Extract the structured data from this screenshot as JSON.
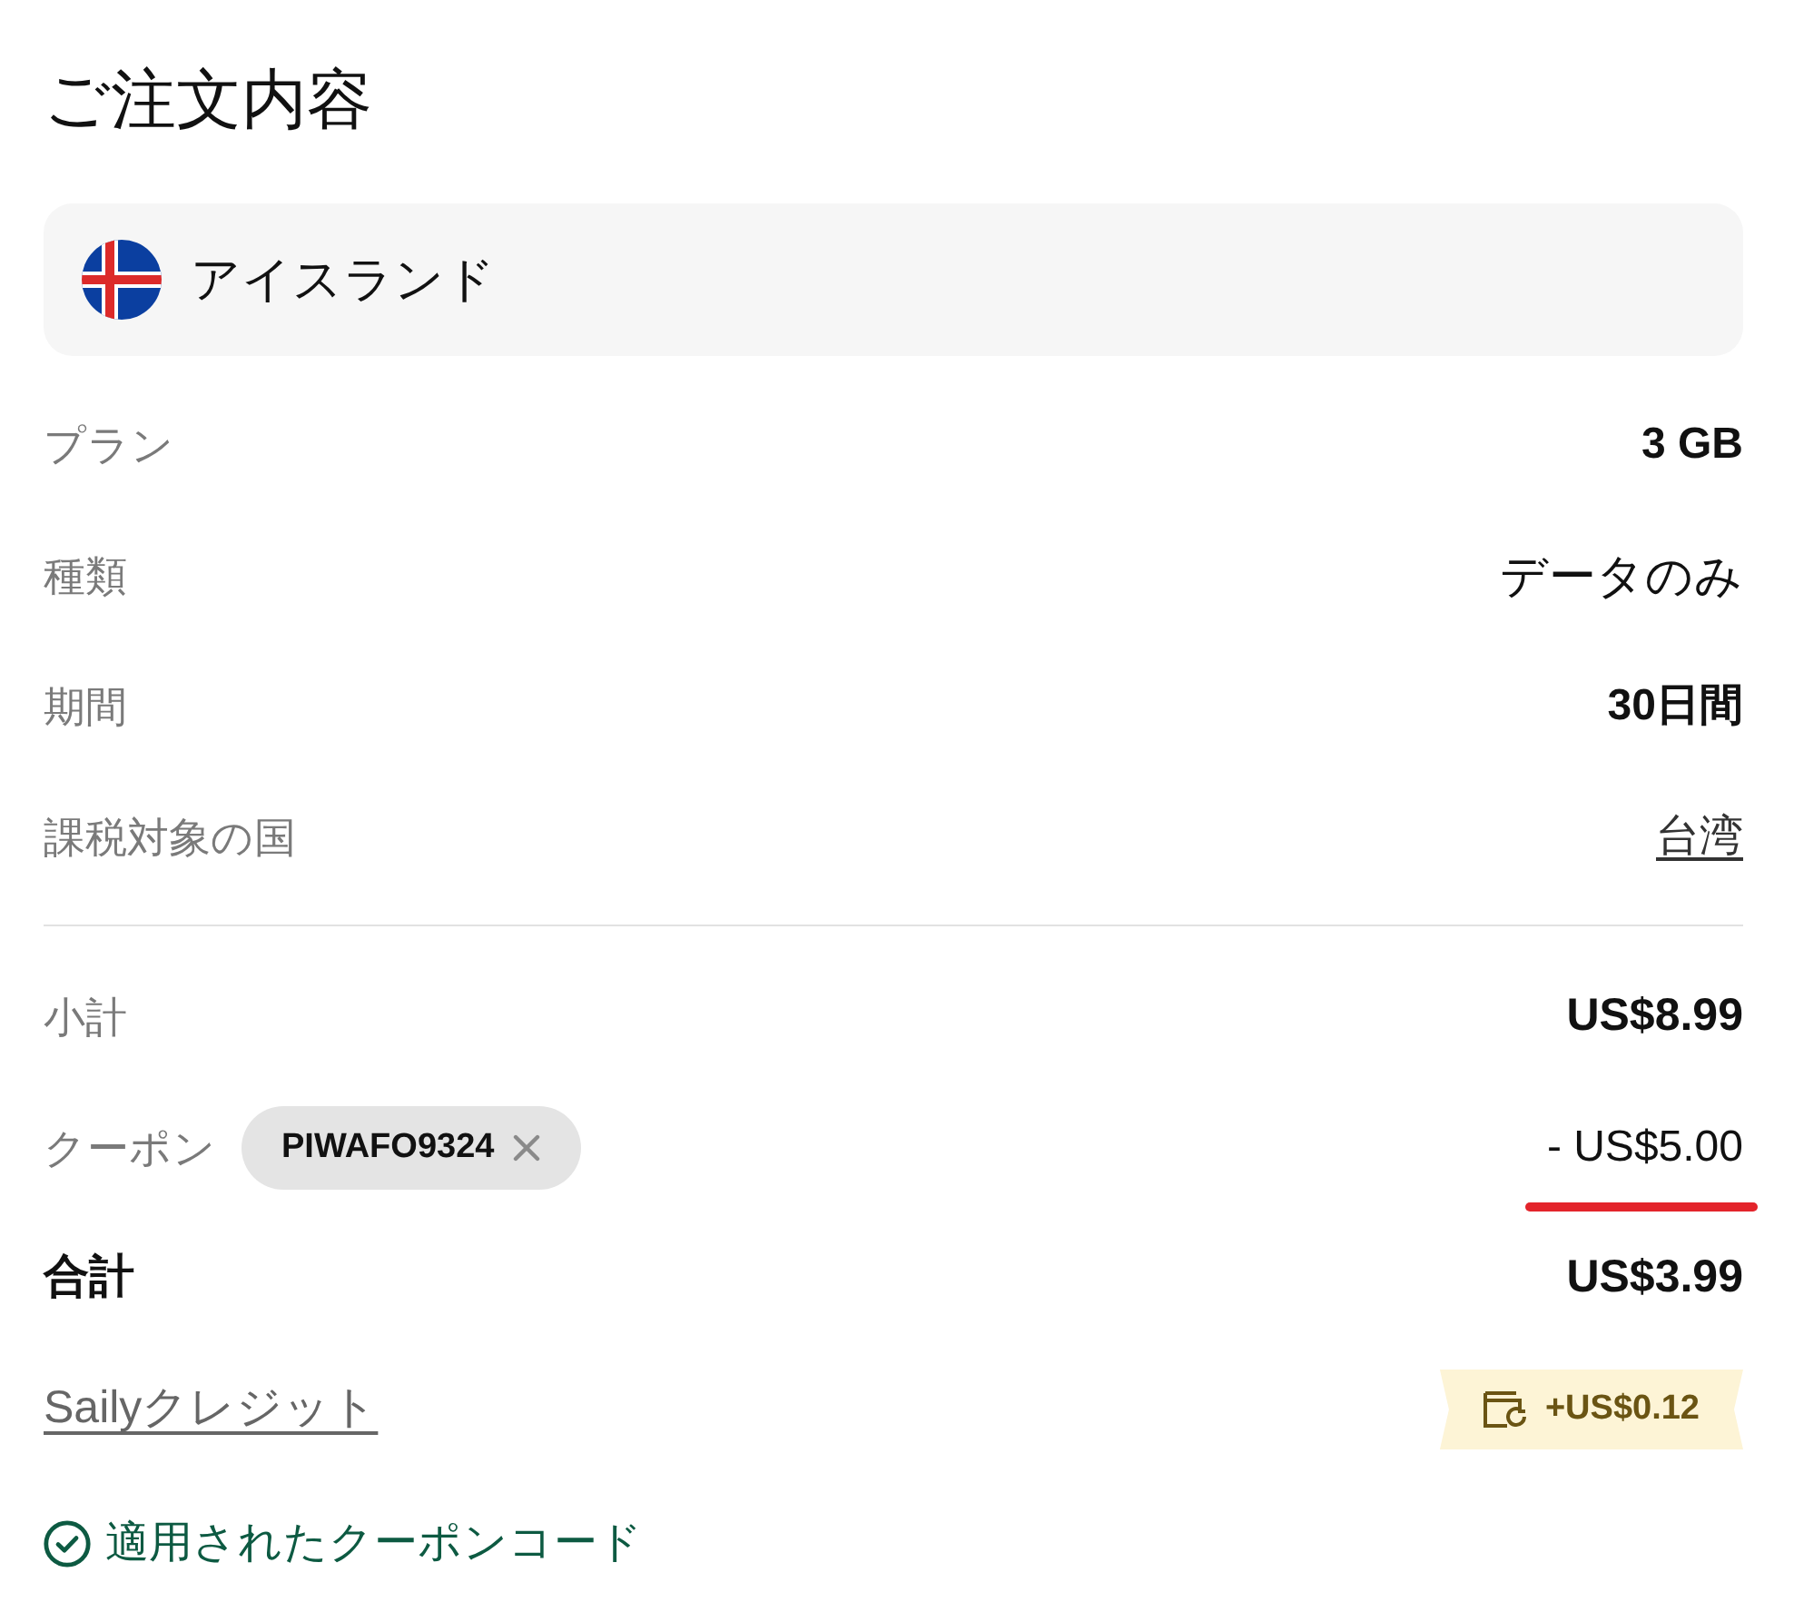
{
  "title": "ご注文内容",
  "destination": {
    "name": "アイスランド"
  },
  "details": [
    {
      "label": "プラン",
      "value": "3 GB",
      "kind": "bold"
    },
    {
      "label": "種類",
      "value": "データのみ",
      "kind": "plain"
    },
    {
      "label": "期間",
      "value": "30日間",
      "kind": "bold"
    },
    {
      "label": "課税対象の国",
      "value": "台湾",
      "kind": "link"
    }
  ],
  "summary": {
    "subtotal": {
      "label": "小計",
      "value": "US$8.99"
    },
    "coupon": {
      "label": "クーポン",
      "code": "PIWAFO9324",
      "value": "- US$5.00",
      "highlighted": true
    },
    "total": {
      "label": "合計",
      "value": "US$3.99"
    }
  },
  "credit": {
    "label": "Sailyクレジット",
    "amount": "+US$0.12"
  },
  "coupon_status": {
    "text": "適用されたクーポンコード",
    "applied": true
  }
}
